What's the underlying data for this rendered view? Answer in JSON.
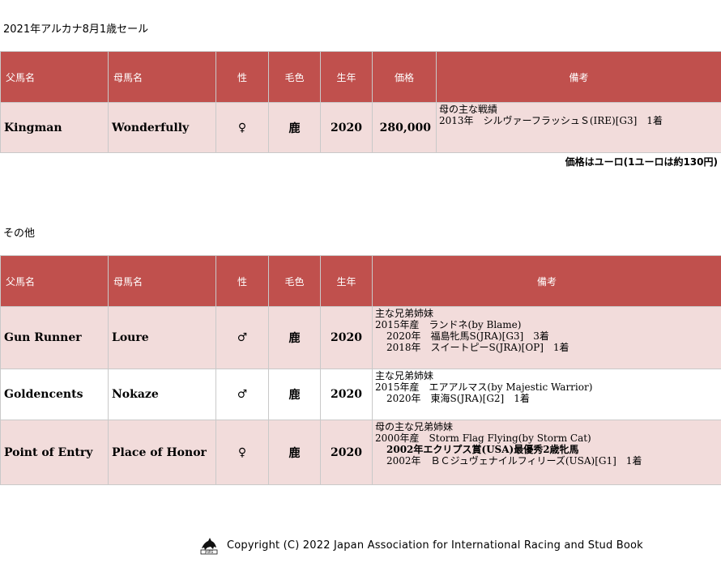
{
  "section1": {
    "title": "2021年アルカナ8月1歳セール",
    "headers": [
      "父馬名",
      "母馬名",
      "性",
      "毛色",
      "生年",
      "価格",
      "備考"
    ],
    "rows": [
      {
        "sire": "Kingman",
        "dam": "Wonderfully",
        "sex": "♀",
        "color": "鹿",
        "year": "2020",
        "price": "280,000",
        "notes": [
          "母の主な戦績",
          "2013年　シルヴァーフラッシュＳ(IRE)[G3]　1着"
        ]
      }
    ],
    "currency_note": "価格はユーロ(1ユーロは約130円)"
  },
  "section2": {
    "title": "その他",
    "headers": [
      "父馬名",
      "母馬名",
      "性",
      "毛色",
      "生年",
      "備考"
    ],
    "rows": [
      {
        "sire": "Gun Runner",
        "dam": "Loure",
        "sex": "♂",
        "color": "鹿",
        "year": "2020",
        "notes": [
          "主な兄弟姉妹",
          "2015年産　ランドネ(by Blame)",
          "2020年　福島牝馬S(JRA)[G3]　3着",
          "2018年　スイートピーS(JRA)[OP]　1着"
        ]
      },
      {
        "sire": "Goldencents",
        "dam": "Nokaze",
        "sex": "♂",
        "color": "鹿",
        "year": "2020",
        "notes": [
          "主な兄弟姉妹",
          "2015年産　エアアルマス(by Majestic Warrior)",
          "2020年　東海S(JRA)[G2]　1着"
        ]
      },
      {
        "sire": "Point of Entry",
        "dam": "Place of Honor",
        "sex": "♀",
        "color": "鹿",
        "year": "2020",
        "notes": [
          "母の主な兄弟姉妹",
          "2000年産　Storm Flag Flying(by Storm Cat)",
          "2002年エクリプス賞(USA)最優秀2歳牝馬",
          "2002年　ＢＣジュヴェナイルフィリーズ(USA)[G1]　1着"
        ]
      }
    ]
  },
  "footer": {
    "logo_icon": "jairs-horse-logo",
    "copyright": "Copyright (C) 2022 Japan Association for International Racing and Stud Book"
  },
  "colors": {
    "header_bg": "#c0504d",
    "row_pink": "#f2dcdb"
  }
}
